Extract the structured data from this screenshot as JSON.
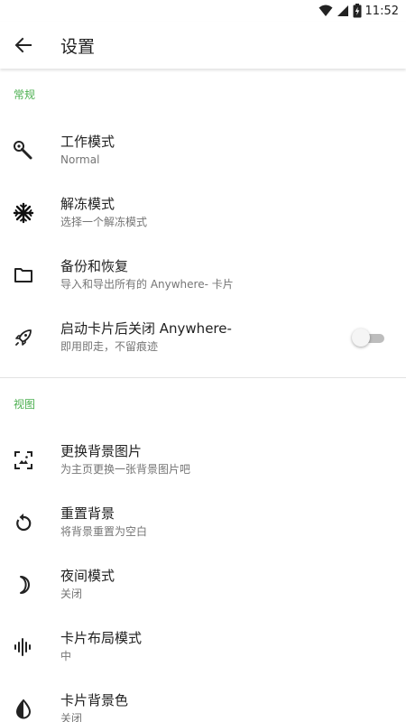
{
  "status_bar": {
    "time": "11:52"
  },
  "app_bar": {
    "title": "设置"
  },
  "colors": {
    "accent": "#4caf50"
  },
  "sections": [
    {
      "header": "常规",
      "items": [
        {
          "title": "工作模式",
          "subtitle": "Normal",
          "icon": "wrench-icon"
        },
        {
          "title": "解冻模式",
          "subtitle": "选择一个解冻模式",
          "icon": "snowflake-icon"
        },
        {
          "title": "备份和恢复",
          "subtitle": "导入和导出所有的 Anywhere- 卡片",
          "icon": "folder-icon"
        },
        {
          "title": "启动卡片后关闭 Anywhere-",
          "subtitle": "即用即走，不留痕迹",
          "icon": "rocket-icon",
          "toggle": false
        }
      ]
    },
    {
      "header": "视图",
      "items": [
        {
          "title": "更换背景图片",
          "subtitle": "为主页更换一张背景图片吧",
          "icon": "wallpaper-icon"
        },
        {
          "title": "重置背景",
          "subtitle": "将背景重置为空白",
          "icon": "reset-icon"
        },
        {
          "title": "夜间模式",
          "subtitle": "关闭",
          "icon": "moon-icon"
        },
        {
          "title": "卡片布局模式",
          "subtitle": "中",
          "icon": "waveform-icon"
        },
        {
          "title": "卡片背景色",
          "subtitle": "关闭",
          "icon": "contrast-icon"
        }
      ]
    }
  ]
}
